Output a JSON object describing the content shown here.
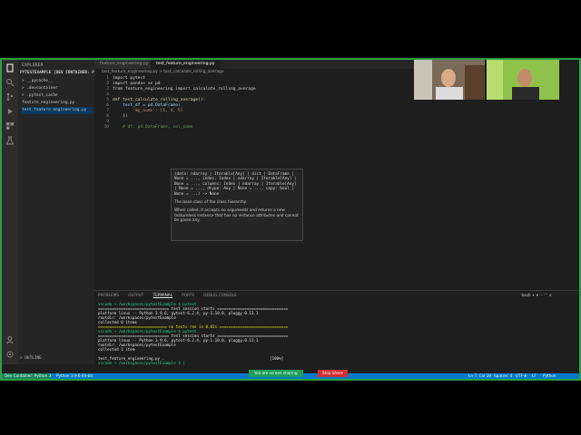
{
  "colors": {
    "accent": "#007acc",
    "share_green": "#1e9e5a",
    "stop_red": "#d32f2f",
    "frame_border": "#2ea043"
  },
  "sidebar": {
    "title": "EXPLORER",
    "root": "PYTESTEXAMPLE [DEV CONTAINER: PY...",
    "items": [
      {
        "label": "> __pycache__"
      },
      {
        "label": "> .devcontainer"
      },
      {
        "label": "> .pytest_cache"
      },
      {
        "label": "feature_engineering.py"
      },
      {
        "label": "test_feature_engineering.py"
      }
    ],
    "outline": "> OUTLINE"
  },
  "tabs": [
    {
      "label": "feature_engineering.py"
    },
    {
      "label": "test_feature_engineering.py"
    }
  ],
  "breadcrumb": "test_feature_engineering.py > test_calculate_rolling_average",
  "code_lines": [
    {
      "n": "1",
      "text": "import pytest"
    },
    {
      "n": "2",
      "text": "import pandas as pd"
    },
    {
      "n": "3",
      "text": "from feature_engineering import calculate_rolling_average"
    },
    {
      "n": "4",
      "text": ""
    },
    {
      "n": "5",
      "text": "def test_calculate_rolling_average():"
    },
    {
      "n": "6",
      "text": "    test_df = pd.DataFrame("
    },
    {
      "n": "7",
      "text": "        'my_nums': [1, 4, 5]"
    },
    {
      "n": "8",
      "text": "    })"
    },
    {
      "n": "9",
      "text": ""
    },
    {
      "n": "10",
      "text": "    # df: pd.DataFrame, col_name"
    }
  ],
  "hover": {
    "signature": "(data: ndarray | Iterable[Any] | dict | DataFrame | None = ..., index: Index | ndarray | Iterable[Any] | None = ..., columns: Index | ndarray | Iterable[Any] | None = ..., dtype: Any | None = ..., copy: bool | None = ...) -> None",
    "doc1": "The base class of the class hierarchy.",
    "doc2": "When called, it accepts no arguments and returns a new featureless instance that has no instance attributes and cannot be given any."
  },
  "panel": {
    "tabs": [
      "PROBLEMS",
      "OUTPUT",
      "TERMINAL",
      "PORTS",
      "DEBUG CONSOLE"
    ],
    "active_tab": "TERMINAL",
    "tools": "bash  +  ▾  ⋯  ^  ×"
  },
  "terminal": [
    {
      "cls": "g",
      "text": "vscode → /workspaces/pytestExample $ pytest"
    },
    {
      "cls": "w",
      "text": "=============================== test session starts ==============================="
    },
    {
      "cls": "w",
      "text": "platform linux -- Python 3.9.6, pytest-6.2.4, py-1.10.0, pluggy-0.13.1"
    },
    {
      "cls": "w",
      "text": "rootdir: /workspaces/pytestExample"
    },
    {
      "cls": "w",
      "text": "collected 0 items"
    },
    {
      "cls": "y",
      "text": "============================== no tests ran in 0.01s =============================="
    },
    {
      "cls": "g",
      "text": "vscode → /workspaces/pytestExample $ pytest"
    },
    {
      "cls": "w",
      "text": "=============================== test session starts ==============================="
    },
    {
      "cls": "w",
      "text": "platform linux -- Python 3.9.6, pytest-6.2.4, py-1.10.0, pluggy-0.13.1"
    },
    {
      "cls": "w",
      "text": "rootdir: /workspaces/pytestExample"
    },
    {
      "cls": "w",
      "text": "collected 1 item"
    },
    {
      "cls": "w",
      "text": ""
    },
    {
      "cls": "w",
      "text": "test_feature_engineering.py .                                              [100%]"
    },
    {
      "cls": "g",
      "text": "vscode → /workspaces/pytestExample $ |"
    }
  ],
  "status": {
    "remote": "Dev Container: Python 3",
    "python": "Python 3.9.6 64-bit",
    "share": "You are screen sharing",
    "stop": "Stop Share",
    "position": "Ln 7, Col 28",
    "spaces": "Spaces: 4",
    "encoding": "UTF-8",
    "eol": "LF",
    "lang": "Python"
  }
}
